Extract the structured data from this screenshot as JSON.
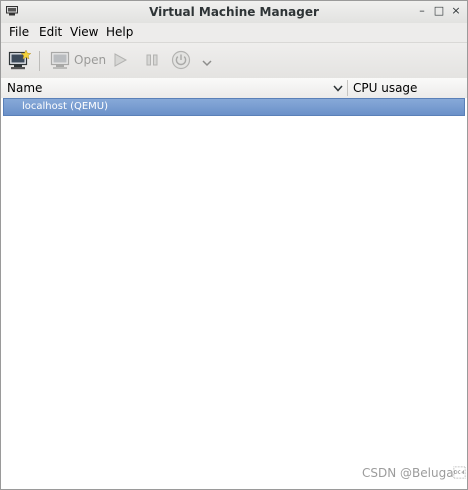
{
  "window": {
    "title": "Virtual Machine Manager",
    "controls": {
      "minimize": "–",
      "maximize": "□",
      "close": "×"
    }
  },
  "menubar": {
    "items": [
      {
        "label": "File"
      },
      {
        "label": "Edit"
      },
      {
        "label": "View"
      },
      {
        "label": "Help"
      }
    ]
  },
  "toolbar": {
    "new_vm_icon": "new-vm-icon",
    "open_label": "Open",
    "run_icon": "play-icon",
    "pause_icon": "pause-icon",
    "shutdown_icon": "power-icon",
    "shutdown_menu_icon": "chevron-down-icon",
    "disabled_color": "#9a9a98"
  },
  "list": {
    "columns": [
      {
        "label": "Name"
      },
      {
        "label": "CPU usage"
      }
    ],
    "rows": [
      {
        "label": "localhost (QEMU)",
        "selected": true
      }
    ],
    "selection_color": "#7b9ed2"
  },
  "watermark": "CSDN @Beluga\u0014"
}
